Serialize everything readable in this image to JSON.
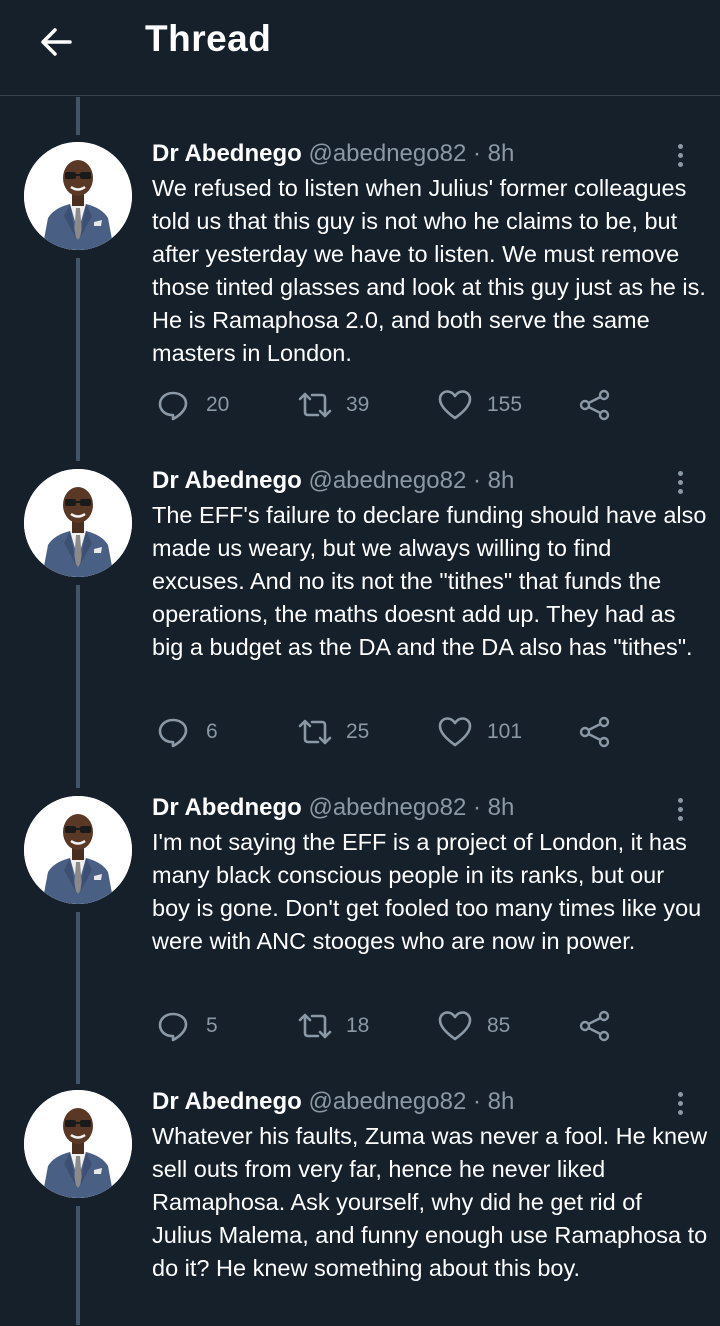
{
  "header": {
    "title": "Thread",
    "back_icon": "arrow-left-icon"
  },
  "tweets": [
    {
      "name": "Dr Abednego",
      "handle": "@abednego82",
      "separator": "·",
      "time": "8h",
      "text": "We refused to listen when Julius' former colleagues told us that this guy is not who he claims to be, but after yesterday we have to listen. We must remove those tinted glasses and look at this guy just as he is. He is Ramaphosa 2.0, and both serve the same masters in London.",
      "replies": "20",
      "retweets": "39",
      "likes": "155"
    },
    {
      "name": "Dr Abednego",
      "handle": "@abednego82",
      "separator": "·",
      "time": "8h",
      "text": "The EFF's failure to declare funding should have also made us weary, but we always willing to find excuses. And no its not the \"tithes\" that funds the operations, the maths doesnt add up. They had as big a budget as the DA and the DA also has \"tithes\".",
      "replies": "6",
      "retweets": "25",
      "likes": "101"
    },
    {
      "name": "Dr Abednego",
      "handle": "@abednego82",
      "separator": "·",
      "time": "8h",
      "text": "I'm not saying the EFF is a project of London, it has many black conscious people in its ranks, but our boy is gone. Don't get fooled too many times like you were with ANC stooges who are now in power.",
      "replies": "5",
      "retweets": "18",
      "likes": "85"
    },
    {
      "name": "Dr Abednego",
      "handle": "@abednego82",
      "separator": "·",
      "time": "8h",
      "text": "Whatever his faults, Zuma was never a fool. He knew sell outs from very far, hence he never liked Ramaphosa. Ask yourself, why did he get rid of Julius Malema, and funny enough use Ramaphosa to do it? He knew something about this boy."
    }
  ],
  "colors": {
    "background": "#15202b",
    "text_primary": "#ffffff",
    "text_secondary": "#8b98a5",
    "thread_line": "#425466",
    "divider": "#38444d"
  }
}
